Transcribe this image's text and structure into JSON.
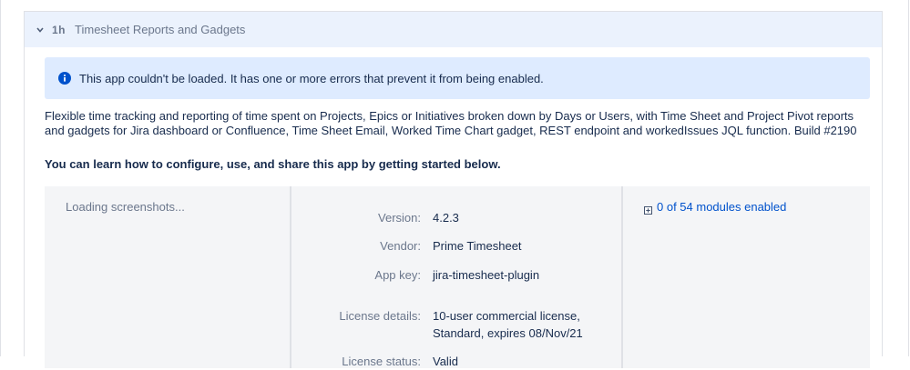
{
  "panel": {
    "badge": "1h",
    "title": "Timesheet Reports and Gadgets"
  },
  "alert": {
    "icon": "info-icon",
    "message": "This app couldn't be loaded. It has one or more errors that prevent it from being enabled."
  },
  "description": "Flexible time tracking and reporting of time spent on Projects, Epics or Initiatives broken down by Days or Users, with Time Sheet and Project Pivot reports and gadgets for Jira dashboard or Confluence, Time Sheet Email, Worked Time Chart gadget, REST endpoint and workedIssues JQL function. Build #2190",
  "learn_more": "You can learn how to configure, use, and share this app by getting started below.",
  "screenshots": {
    "loading": "Loading screenshots..."
  },
  "details": {
    "version_label": "Version:",
    "version": "4.2.3",
    "vendor_label": "Vendor:",
    "vendor": "Prime Timesheet",
    "app_key_label": "App key:",
    "app_key": "jira-timesheet-plugin",
    "license_details_label": "License details:",
    "license_details_line1": "10-user commercial license,",
    "license_details_line2": "Standard, expires 08/Nov/21",
    "license_status_label": "License status:",
    "license_status": "Valid"
  },
  "modules": {
    "label": "0 of 54 modules enabled"
  },
  "colors": {
    "header_bg": "#ebf2fd",
    "alert_bg": "#deebff",
    "info_icon": "#0052cc",
    "link": "#0052cc",
    "details_bg": "#f4f5f7"
  }
}
